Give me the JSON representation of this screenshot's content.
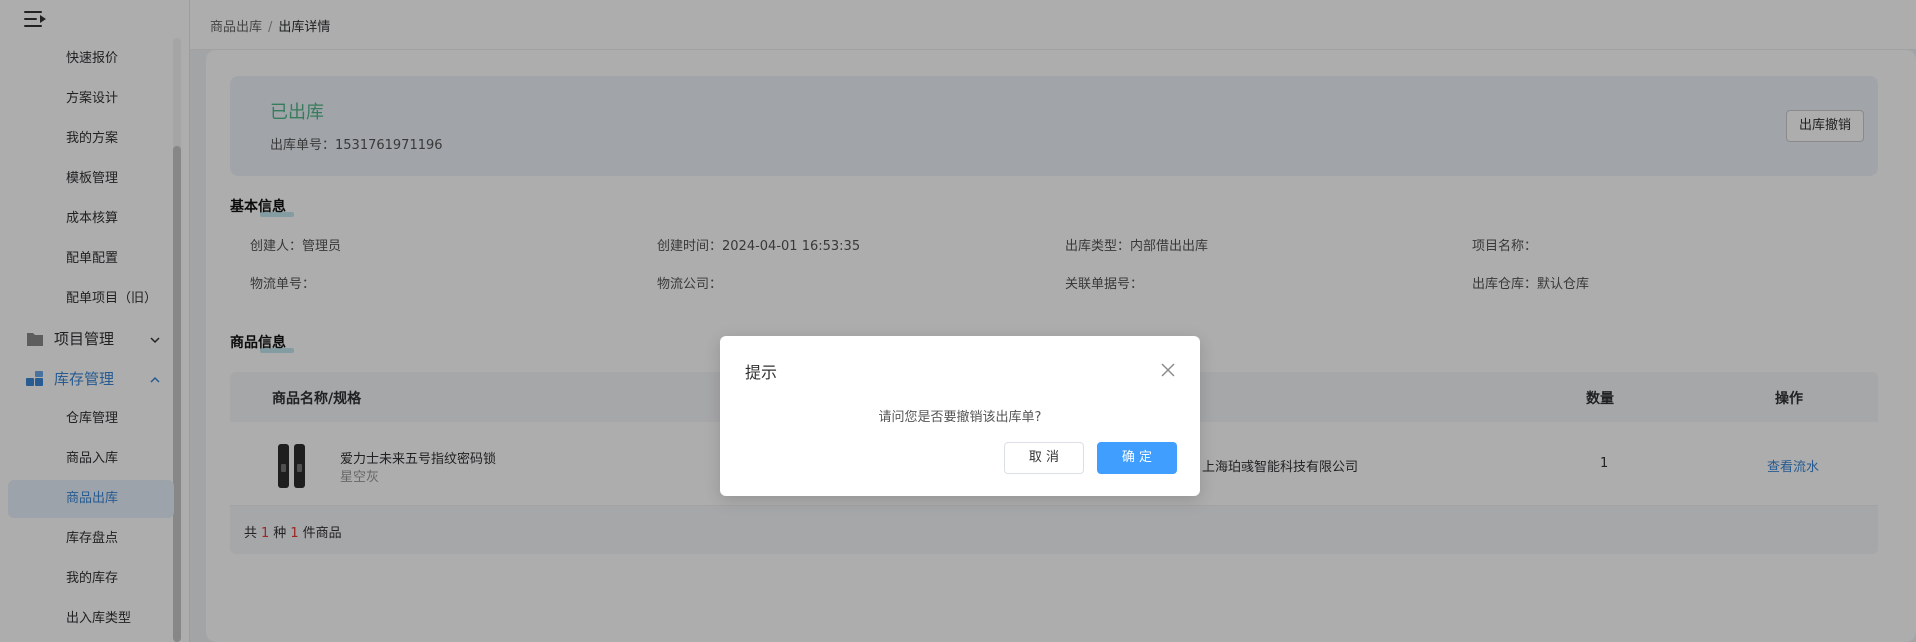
{
  "sidebar": {
    "items": [
      {
        "label": "快速报价"
      },
      {
        "label": "方案设计"
      },
      {
        "label": "我的方案"
      },
      {
        "label": "模板管理"
      },
      {
        "label": "成本核算"
      },
      {
        "label": "配单配置"
      },
      {
        "label": "配单项目（旧）"
      }
    ],
    "groups": [
      {
        "label": "项目管理",
        "icon": "folder-icon"
      },
      {
        "label": "库存管理",
        "icon": "inventory-icon"
      }
    ],
    "inventory_items": [
      {
        "label": "仓库管理"
      },
      {
        "label": "商品入库"
      },
      {
        "label": "商品出库"
      },
      {
        "label": "库存盘点"
      },
      {
        "label": "我的库存"
      },
      {
        "label": "出入库类型"
      }
    ]
  },
  "breadcrumb": {
    "parent": "商品出库",
    "separator": "/",
    "current": "出库详情"
  },
  "status": {
    "title": "已出库",
    "order_label": "出库单号：",
    "order_no": "1531761971196",
    "revoke_label": "出库撤销",
    "color": "#52b788"
  },
  "basic_info": {
    "title": "基本信息",
    "fields": [
      {
        "label": "创建人：",
        "value": "管理员"
      },
      {
        "label": "创建时间：",
        "value": "2024-04-01 16:53:35"
      },
      {
        "label": "出库类型：",
        "value": "内部借出出库"
      },
      {
        "label": "项目名称：",
        "value": ""
      },
      {
        "label": "物流单号：",
        "value": ""
      },
      {
        "label": "物流公司：",
        "value": ""
      },
      {
        "label": "关联单据号：",
        "value": ""
      },
      {
        "label": "出库仓库：",
        "value": "默认仓库"
      }
    ]
  },
  "goods": {
    "title": "商品信息",
    "headers": {
      "name": "商品名称/规格",
      "qty": "数量",
      "action": "操作"
    },
    "rows": [
      {
        "name": "爱力士未来五号指纹密码锁",
        "spec": "星空灰",
        "supplier": "上海珀彧智能科技有限公司",
        "qty": "1",
        "action": "查看流水"
      }
    ],
    "summary": {
      "prefix": "共",
      "kinds": "1",
      "middle": "种",
      "count": "1",
      "suffix": "件商品"
    }
  },
  "dialog": {
    "title": "提示",
    "message": "请问您是否要撤销该出库单?",
    "cancel_label": "取 消",
    "confirm_label": "确 定"
  },
  "colors": {
    "accent": "#409eff",
    "link": "#3a86d6",
    "highlight": "#e53935"
  }
}
